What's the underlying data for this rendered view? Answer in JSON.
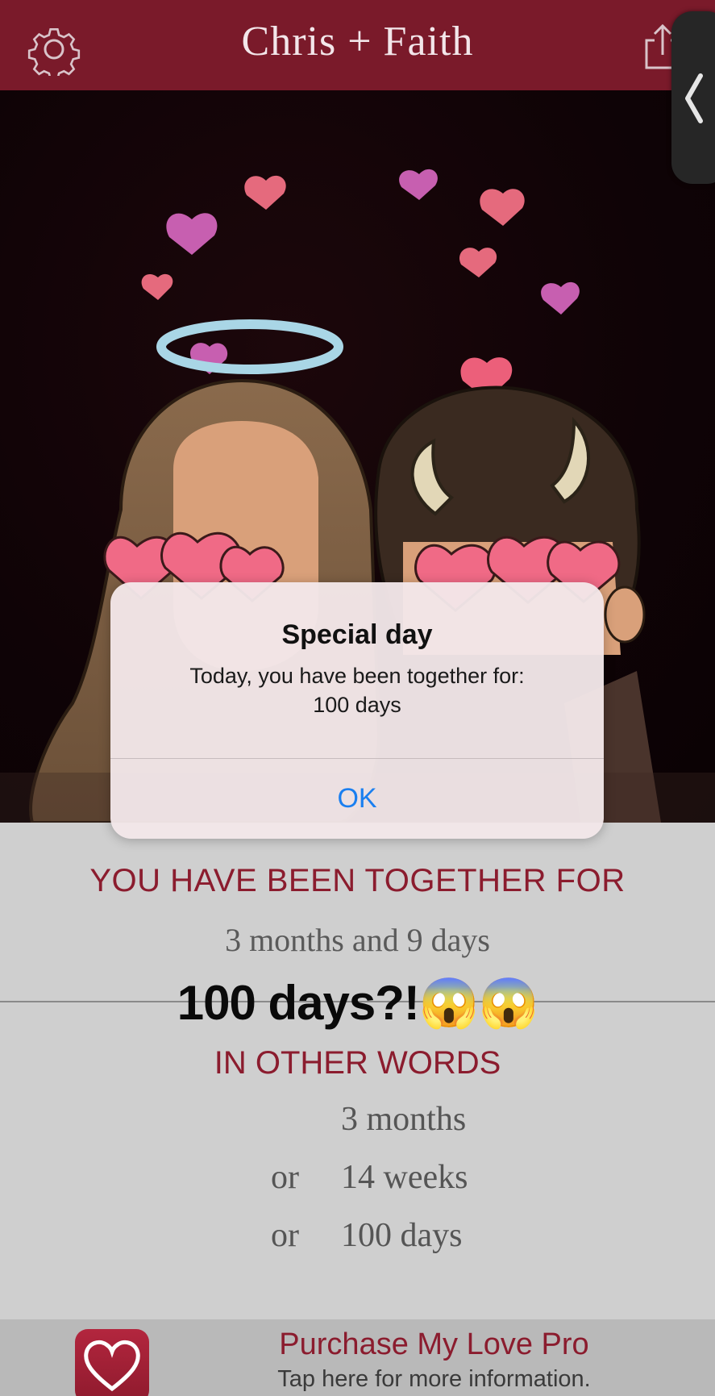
{
  "header": {
    "title": "Chris + Faith",
    "settings_icon": "gear-icon",
    "share_icon": "share-icon",
    "side_tab_icon": "chevron-left-icon"
  },
  "photo": {
    "description_icon": "couple-photo"
  },
  "alert": {
    "title": "Special day",
    "message": "Today, you have been together for:\n100 days",
    "ok_label": "OK"
  },
  "stats": {
    "together_label": "YOU HAVE BEEN TOGETHER FOR",
    "duration": "3 months and 9 days",
    "caption": "100 days?!😱😱",
    "other_words_label": "IN OTHER WORDS",
    "equivalents": [
      {
        "prefix": "",
        "value": "3 months"
      },
      {
        "prefix": "or",
        "value": "14 weeks"
      },
      {
        "prefix": "or",
        "value": "100 days"
      }
    ]
  },
  "promo": {
    "title": "Purchase My Love Pro",
    "subtitle": "Tap here for more information.",
    "icon": "heart-icon"
  },
  "colors": {
    "header_bg": "#7a1a2a",
    "accent": "#8b1c2e",
    "alert_button": "#1a7ff0"
  }
}
